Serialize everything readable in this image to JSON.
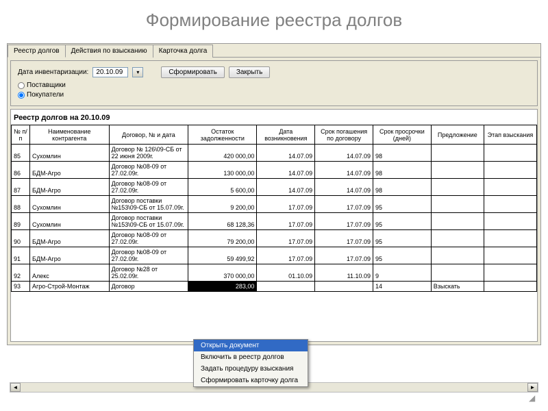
{
  "title": "Формирование реестра долгов",
  "tabs": [
    "Реестр долгов",
    "Действия по взысканию",
    "Карточка долга"
  ],
  "toolbar": {
    "date_label": "Дата инвентаризации:",
    "date_value": "20.10.09",
    "form_btn": "Сформировать",
    "close_btn": "Закрыть",
    "radio_suppliers": "Поставщики",
    "radio_buyers": "Покупатели"
  },
  "report_title": "Реестр долгов на 20.10.09",
  "columns": {
    "num": "№ п/п",
    "name": "Наименование контрагента",
    "contract": "Договор, № и дата",
    "balance": "Остаток задолженности",
    "date_origin": "Дата возникновения",
    "date_due": "Срок погашения по договору",
    "overdue": "Срок просрочки (дней)",
    "proposal": "Предложение",
    "stage": "Этап взыскания"
  },
  "rows": [
    {
      "n": "85",
      "name": "Сухомлин",
      "contract": "Договор № 126\\09-СБ от 22 июня 2009г.",
      "bal": "420 000,00",
      "d1": "14.07.09",
      "d2": "14.07.09",
      "ov": "98",
      "prop": "",
      "st": ""
    },
    {
      "n": "86",
      "name": "БДМ-Агро",
      "contract": "Договор №08-09 от 27.02.09г.",
      "bal": "130 000,00",
      "d1": "14.07.09",
      "d2": "14.07.09",
      "ov": "98",
      "prop": "",
      "st": ""
    },
    {
      "n": "87",
      "name": "БДМ-Агро",
      "contract": "Договор №08-09 от 27.02.09г.",
      "bal": "5 600,00",
      "d1": "14.07.09",
      "d2": "14.07.09",
      "ov": "98",
      "prop": "",
      "st": ""
    },
    {
      "n": "88",
      "name": "Сухомлин",
      "contract": "Договор поставки №153\\09-СБ от 15.07.09г.",
      "bal": "9 200,00",
      "d1": "17.07.09",
      "d2": "17.07.09",
      "ov": "95",
      "prop": "",
      "st": ""
    },
    {
      "n": "89",
      "name": "Сухомлин",
      "contract": "Договор поставки №153\\09-СБ от 15.07.09г.",
      "bal": "68 128,36",
      "d1": "17.07.09",
      "d2": "17.07.09",
      "ov": "95",
      "prop": "",
      "st": ""
    },
    {
      "n": "90",
      "name": "БДМ-Агро",
      "contract": "Договор №08-09 от 27.02.09г.",
      "bal": "79 200,00",
      "d1": "17.07.09",
      "d2": "17.07.09",
      "ov": "95",
      "prop": "",
      "st": ""
    },
    {
      "n": "91",
      "name": "БДМ-Агро",
      "contract": "Договор №08-09 от 27.02.09г.",
      "bal": "59 499,92",
      "d1": "17.07.09",
      "d2": "17.07.09",
      "ov": "95",
      "prop": "",
      "st": ""
    },
    {
      "n": "92",
      "name": "Алекс",
      "contract": "Договор №28 от 25.02.09г.",
      "bal": "370 000,00",
      "d1": "01.10.09",
      "d2": "11.10.09",
      "ov": "9",
      "prop": "",
      "st": ""
    },
    {
      "n": "93",
      "name": "Агро-Строй-Монтаж",
      "contract": "Договор",
      "bal": "283,00",
      "d1": "",
      "d2": "",
      "ov": "14",
      "prop": "Взыскать",
      "st": "",
      "sel": true
    }
  ],
  "context_menu": [
    "Открыть документ",
    "Включить в реестр долгов",
    "Задать процедуру взыскания",
    "Сформировать карточку долга"
  ]
}
